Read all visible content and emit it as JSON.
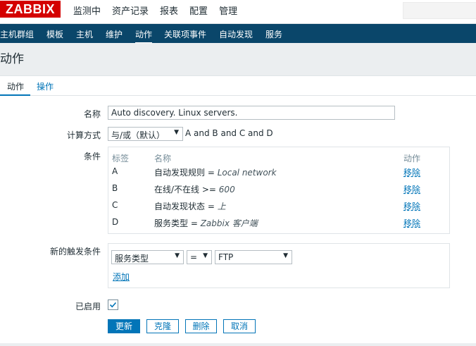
{
  "brand": {
    "logo_text": "ZABBIX",
    "color": "#d40000"
  },
  "top_nav": [
    "监测中",
    "资产记录",
    "报表",
    "配置",
    "管理"
  ],
  "sub_nav": [
    "主机群组",
    "模板",
    "主机",
    "维护",
    "动作",
    "关联项事件",
    "自动发现",
    "服务"
  ],
  "page_title": "动作",
  "tabs": [
    "动作",
    "操作"
  ],
  "form": {
    "name_label": "名称",
    "name_value": "Auto discovery. Linux servers.",
    "calc_label": "计算方式",
    "calc_value": "与/或（默认）",
    "calc_formula": "A and B and C and D",
    "conditions_label": "条件",
    "conditions_headers": [
      "标签",
      "名称",
      "动作"
    ],
    "conditions": [
      {
        "tag": "A",
        "name": "自动发现规则 = ",
        "value": "Local network",
        "action": "移除"
      },
      {
        "tag": "B",
        "name": "在线/不在线 >= ",
        "value": "600",
        "action": "移除"
      },
      {
        "tag": "C",
        "name": "自动发现状态 = ",
        "value": "上",
        "action": "移除"
      },
      {
        "tag": "D",
        "name": "服务类型 = ",
        "value": "Zabbix 客户端",
        "action": "移除"
      }
    ],
    "new_condition_label": "新的触发条件",
    "new_condition_type": "服务类型",
    "new_condition_op": "=",
    "new_condition_value": "FTP",
    "add_link": "添加",
    "enabled_label": "已启用",
    "enabled": true
  },
  "buttons": {
    "update": "更新",
    "clone": "克隆",
    "delete": "删除",
    "cancel": "取消"
  }
}
